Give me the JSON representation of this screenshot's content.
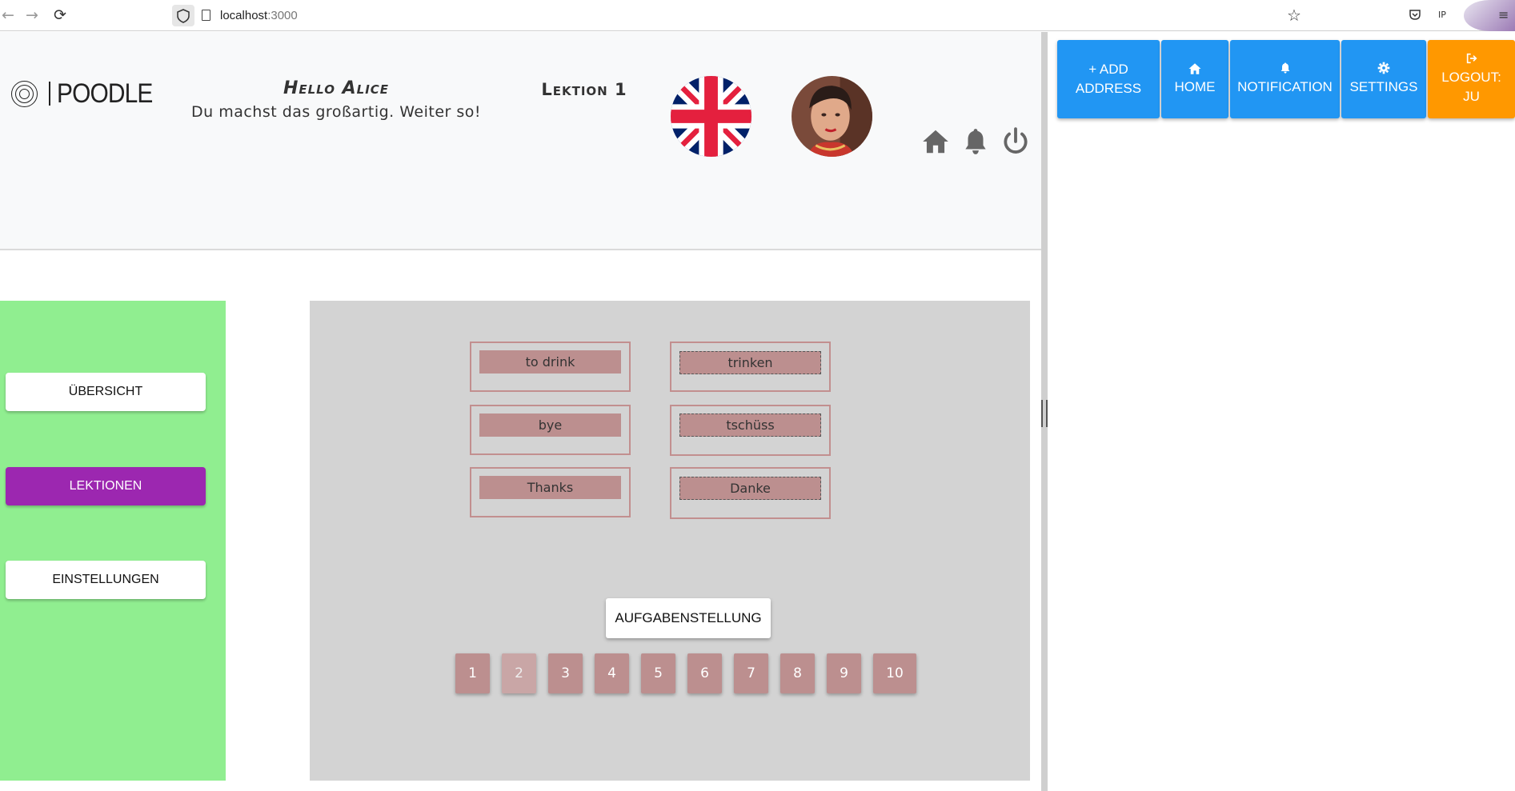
{
  "browser": {
    "url_host": "localhost",
    "url_port": ":3000",
    "ext_label": "IP"
  },
  "header": {
    "logo_text": "POODLE",
    "greeting": "Hello Alice",
    "encouragement": "Du machst das großartig. Weiter so!",
    "lesson_title": "Lektion 1"
  },
  "sidebar": {
    "items": [
      {
        "label": "ÜBERSICHT"
      },
      {
        "label": "LEKTIONEN",
        "active": true
      },
      {
        "label": "EINSTELLUNGEN"
      }
    ]
  },
  "exercise": {
    "left": [
      "to drink",
      "bye",
      "Thanks"
    ],
    "right": [
      "trinken",
      "tschüss",
      "Danke"
    ],
    "task_button": "AUFGABENSTELLUNG",
    "pages": [
      "1",
      "2",
      "3",
      "4",
      "5",
      "6",
      "7",
      "8",
      "9",
      "10"
    ],
    "current_page": "2"
  },
  "right_panel": {
    "buttons": [
      {
        "icon": "plus-icon",
        "label": "ADD ADDRESS",
        "line1": "+ ADD",
        "line2": "ADDRESS"
      },
      {
        "icon": "home-icon",
        "label": "HOME"
      },
      {
        "icon": "bell-icon",
        "label": "NOTIFICATION"
      },
      {
        "icon": "gear-icon",
        "label": "SETTINGS"
      },
      {
        "icon": "logout-icon",
        "label": "LOGOUT: JU",
        "line1": "LOGOUT:",
        "line2": "JU"
      }
    ]
  },
  "colors": {
    "header_bg": "#f8f9fa",
    "sidebar_bg": "#90ee90",
    "active_purple": "#9c27b0",
    "main_bg": "#d3d3d3",
    "card_fill": "#bc8f8f",
    "primary_blue": "#2196f3",
    "logout_orange": "#ff9800"
  }
}
